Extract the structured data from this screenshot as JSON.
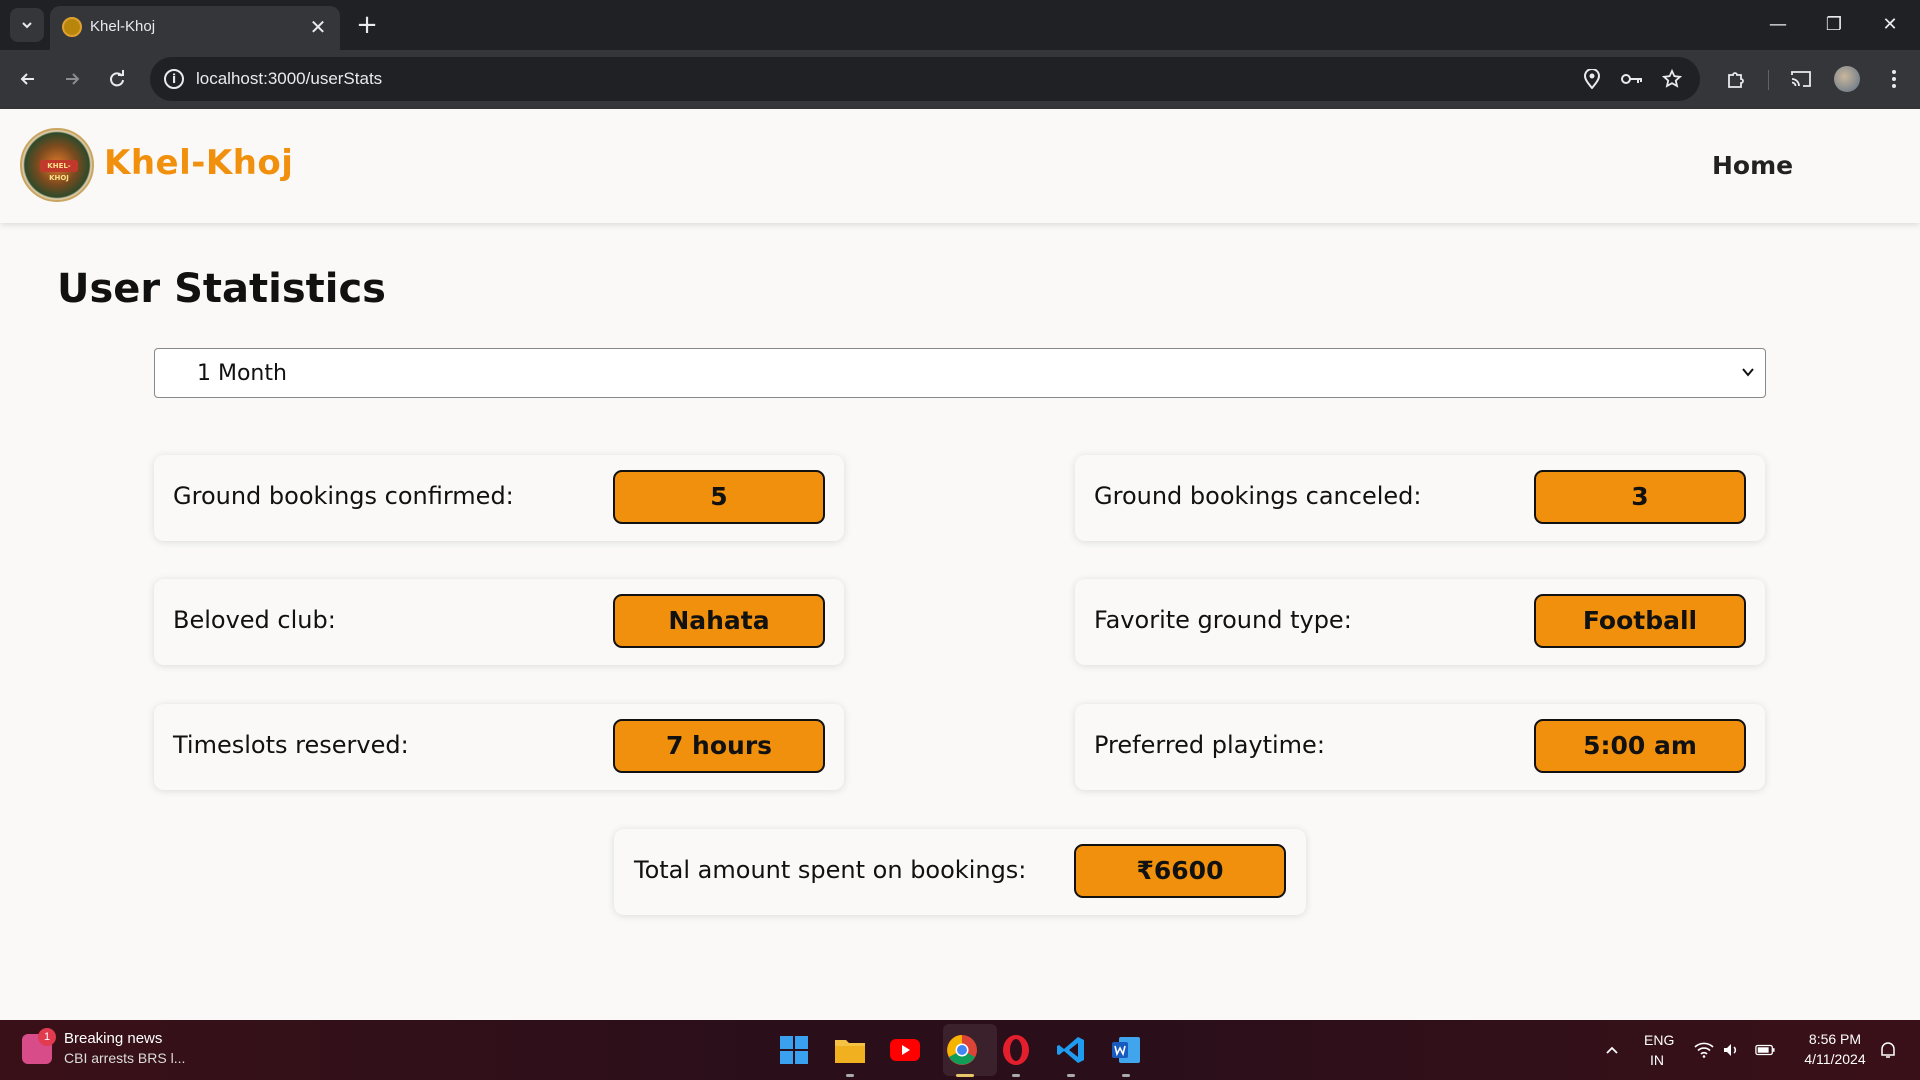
{
  "browser": {
    "tab_title": "Khel-Khoj",
    "url": "localhost:3000/userStats",
    "tab_close": "✕",
    "new_tab": "+",
    "window_minimize": "—",
    "window_restore": "❐",
    "window_close": "✕"
  },
  "header": {
    "brand": "Khel-Khoj",
    "logo_badge": "KHEL-KHOJ",
    "nav_home": "Home"
  },
  "main": {
    "title": "User Statistics",
    "range_select": {
      "value": "1 Month"
    },
    "stats": [
      {
        "label": "Ground bookings confirmed:",
        "value": "5"
      },
      {
        "label": "Ground bookings canceled:",
        "value": "3"
      },
      {
        "label": "Beloved club:",
        "value": "Nahata"
      },
      {
        "label": "Favorite ground type:",
        "value": "Football"
      },
      {
        "label": "Timeslots reserved:",
        "value": "7 hours"
      },
      {
        "label": "Preferred playtime:",
        "value": "5:00 am"
      }
    ],
    "total": {
      "label": "Total amount spent on bookings:",
      "value": "₹6600"
    }
  },
  "taskbar": {
    "news_badge": "1",
    "news_title": "Breaking news",
    "news_subtitle": "CBI arrests BRS l...",
    "language": "ENG",
    "region": "IN",
    "time": "8:56 PM",
    "date": "4/11/2024"
  },
  "colors": {
    "accent": "#f0900d",
    "page_bg": "#faf9f7",
    "chrome_dark": "#202124",
    "chrome_mid": "#35363a"
  }
}
